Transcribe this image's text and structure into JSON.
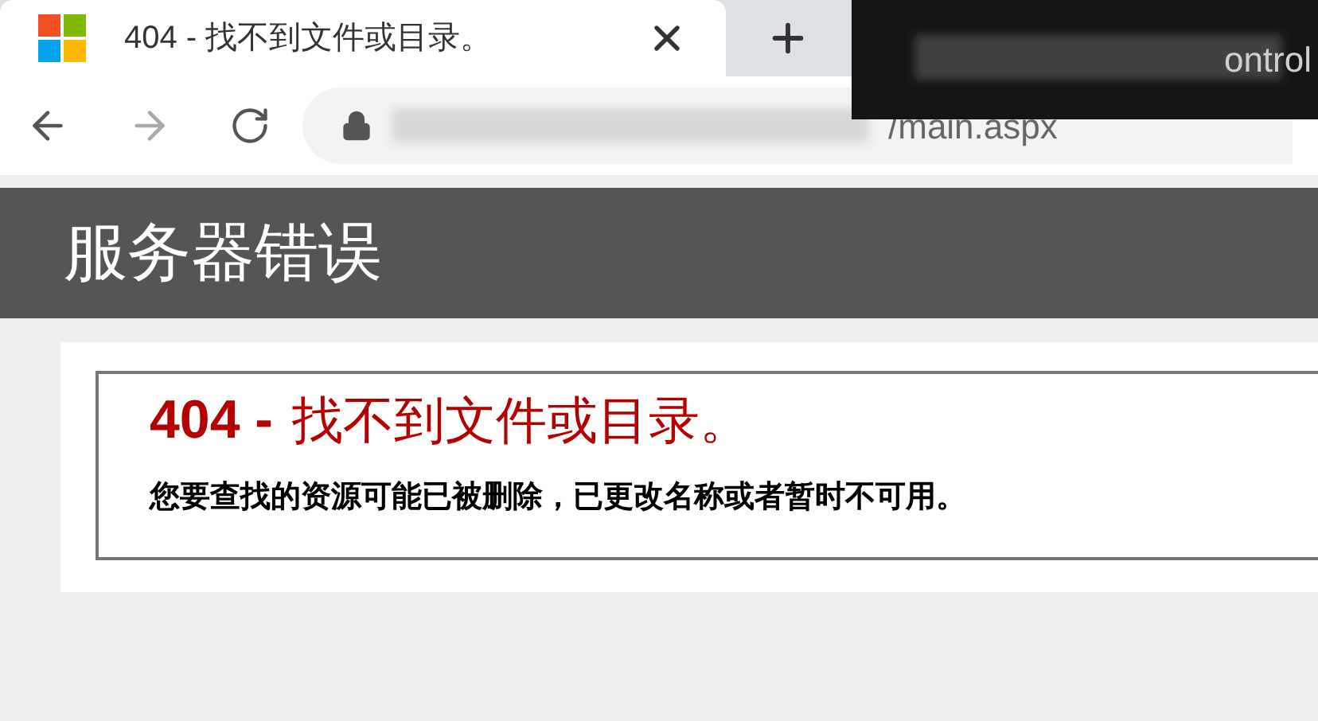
{
  "tab": {
    "title": "404 - 找不到文件或目录。",
    "selected": true
  },
  "address_bar": {
    "url": "/main.aspx"
  },
  "overlay": {
    "text": "ontrol"
  },
  "page": {
    "header": "服务器错误",
    "error_code": "404 -",
    "error_title": "找不到文件或目录。",
    "message": "您要查找的资源可能已被删除，已更改名称或者暂时不可用。"
  }
}
